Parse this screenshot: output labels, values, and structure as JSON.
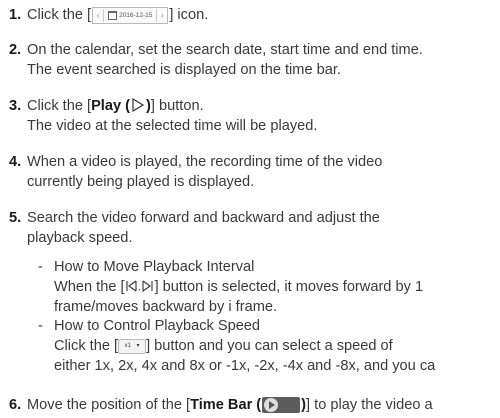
{
  "steps": [
    {
      "num": "1.",
      "pre": "Click the [",
      "date": "2016-12-15",
      "post": "] icon."
    },
    {
      "num": "2.",
      "line1": "On the calendar, set the search date, start time and end time.",
      "line2": "The event searched is displayed on the time bar."
    },
    {
      "num": "3.",
      "pre": "Click the [",
      "bold": "Play (",
      "bold_end": ")",
      "post": "] button.",
      "line2": "The video at the selected time will be played."
    },
    {
      "num": "4.",
      "line1": "When a video is played, the recording time of the video",
      "line2": "currently being played is displayed."
    },
    {
      "num": "5.",
      "line1": "Search the video forward and backward and adjust the",
      "line2": "playback speed."
    },
    {
      "num": "6.",
      "pre": "Move the position of the [",
      "bold": "Time Bar (",
      "bold_end": ")",
      "post": "] to play the video a"
    }
  ],
  "subs": [
    {
      "dash": "-",
      "title": "How to Move Playback Interval",
      "l2_pre": "When the [",
      "l2_post": "] button is selected, it moves forward by 1",
      "l3": "frame/moves backward by i frame."
    },
    {
      "dash": "-",
      "title": "How to Control Playback Speed",
      "l2_pre": "Click the [",
      "speed_label": "x1",
      "l2_post": "] button and you can select a speed of",
      "l3": "either 1x, 2x, 4x and 8x or -1x, -2x, -4x and -8x, and you ca"
    }
  ],
  "icons": {
    "interval": "frame-step-icons",
    "speed": "speed-dropdown-icon",
    "timebar": "timebar-play-icon",
    "play": "play-triangle-icon",
    "calendar": "calendar-icon"
  }
}
